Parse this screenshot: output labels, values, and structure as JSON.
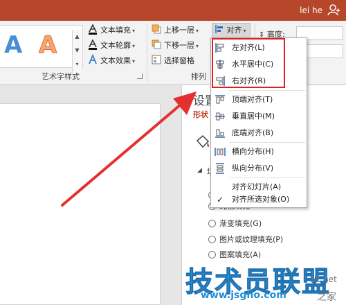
{
  "user": {
    "name": "lei he"
  },
  "ribbon": {
    "wordart": {
      "letter1": "A",
      "letter2": "A",
      "text_fill": "文本填充",
      "text_outline": "文本轮廓",
      "text_effect": "文本效果",
      "group_label": "艺术字样式"
    },
    "arrange": {
      "bring_forward": "上移一层",
      "send_backward": "下移一层",
      "selection_pane": "选择窗格",
      "align": "对齐",
      "group_label": "排列"
    },
    "size": {
      "height_label": "高度:"
    }
  },
  "align_menu": {
    "items": [
      {
        "label": "左对齐(L)",
        "icon": "align-left-icon"
      },
      {
        "label": "水平居中(C)",
        "icon": "align-center-icon"
      },
      {
        "label": "右对齐(R)",
        "icon": "align-right-icon"
      },
      {
        "label": "顶端对齐(T)",
        "icon": "align-top-icon"
      },
      {
        "label": "垂直居中(M)",
        "icon": "align-middle-icon"
      },
      {
        "label": "底端对齐(B)",
        "icon": "align-bottom-icon"
      },
      {
        "label": "横向分布(H)",
        "icon": "distribute-horizontal-icon"
      },
      {
        "label": "纵向分布(V)",
        "icon": "distribute-vertical-icon"
      },
      {
        "label": "对齐幻灯片(A)",
        "icon": ""
      },
      {
        "label": "对齐所选对象(O)",
        "icon": "check-icon"
      }
    ]
  },
  "format_pane": {
    "title": "设置",
    "subtitle": "形状",
    "section": "填",
    "fill_options": [
      {
        "label": "纯色填充",
        "checked": true
      },
      {
        "label": "渐变填充(G)",
        "checked": false
      },
      {
        "label": "图片或纹理填充(P)",
        "checked": false
      },
      {
        "label": "图案填充(A)",
        "checked": false
      }
    ]
  },
  "watermark": {
    "main": "技术员联盟",
    "url": "www.jsgho.com",
    "net": "51.net",
    "home": "之家"
  },
  "colors": {
    "title_bar": "#b7472a",
    "highlight": "#e02020",
    "arrow": "#e53030",
    "accent_text": "#c43e1c"
  }
}
